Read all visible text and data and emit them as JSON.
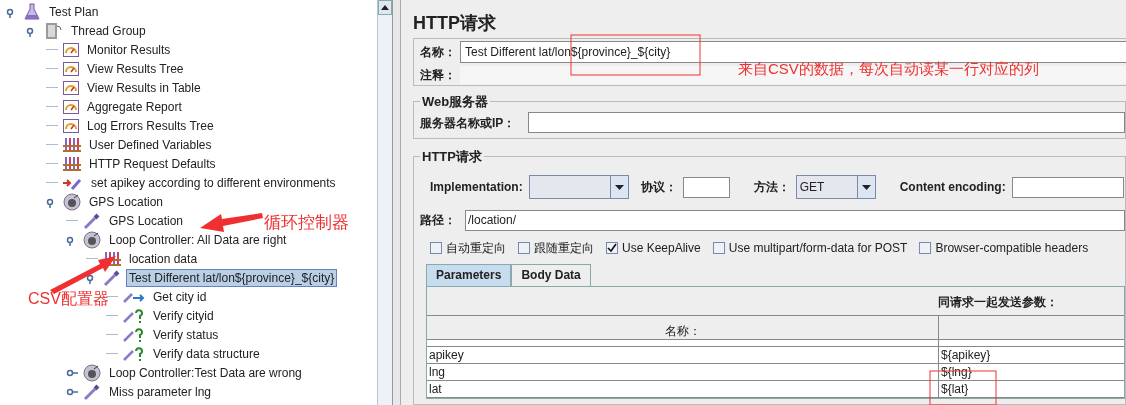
{
  "tree": [
    {
      "label": "Test Plan",
      "kind": "plan",
      "selected": false,
      "expanded": true,
      "children": [
        {
          "label": "Thread Group",
          "kind": "thread",
          "selected": false,
          "expanded": true,
          "children": [
            {
              "label": "Monitor Results",
              "kind": "listener",
              "selected": false
            },
            {
              "label": "View Results Tree",
              "kind": "listener",
              "selected": false
            },
            {
              "label": "View Results in Table",
              "kind": "listener",
              "selected": false
            },
            {
              "label": "Aggregate Report",
              "kind": "listener",
              "selected": false
            },
            {
              "label": "Log Errors Results Tree",
              "kind": "listener",
              "selected": false
            },
            {
              "label": "User Defined Variables",
              "kind": "config",
              "selected": false
            },
            {
              "label": "HTTP Request Defaults",
              "kind": "config",
              "selected": false
            },
            {
              "label": "set apikey according to different environments",
              "kind": "preprocessor",
              "selected": false
            },
            {
              "label": "GPS Location",
              "kind": "controller",
              "selected": false,
              "expanded": true,
              "children": [
                {
                  "label": "GPS Location",
                  "kind": "sampler",
                  "selected": false
                },
                {
                  "label": "Loop Controller: All Data are right",
                  "kind": "controller",
                  "selected": false,
                  "expanded": true,
                  "children": [
                    {
                      "label": "location data",
                      "kind": "config",
                      "selected": false
                    },
                    {
                      "label": "Test Different lat/lon${province}_${city}",
                      "kind": "sampler",
                      "selected": true,
                      "expanded": true,
                      "children": [
                        {
                          "label": "Get city id",
                          "kind": "extractor",
                          "selected": false
                        },
                        {
                          "label": "Verify cityid",
                          "kind": "assertion",
                          "selected": false
                        },
                        {
                          "label": "Verify status",
                          "kind": "assertion",
                          "selected": false
                        },
                        {
                          "label": "Verify data structure",
                          "kind": "assertion",
                          "selected": false
                        }
                      ]
                    }
                  ]
                },
                {
                  "label": "Loop Controller:Test Data are wrong",
                  "kind": "controller",
                  "selected": false,
                  "expanded": false
                },
                {
                  "label": "Miss parameter lng",
                  "kind": "sampler",
                  "selected": false,
                  "expanded": false
                }
              ]
            }
          ]
        }
      ]
    }
  ],
  "panel": {
    "title": "HTTP请求",
    "name_label": "名称：",
    "name_value": "Test Different lat/lon${province}_${city}",
    "comment_label": "注释：",
    "web_server": {
      "legend": "Web服务器",
      "server_label": "服务器名称或IP："
    },
    "http_request": {
      "legend": "HTTP请求",
      "implementation_label": "Implementation:",
      "protocol_label": "协议：",
      "method_label": "方法：",
      "method_value": "GET",
      "encoding_label": "Content encoding:",
      "path_label": "路径：",
      "path_value": "/location/",
      "options": [
        {
          "label": "自动重定向",
          "checked": false
        },
        {
          "label": "跟随重定向",
          "checked": false
        },
        {
          "label": "Use KeepAlive",
          "checked": true
        },
        {
          "label": "Use multipart/form-data for POST",
          "checked": false
        },
        {
          "label": "Browser-compatible headers",
          "checked": false
        }
      ],
      "tabs": [
        {
          "label": "Parameters",
          "selected": true
        },
        {
          "label": "Body Data",
          "selected": false
        }
      ],
      "params_caption": "同请求一起发送参数：",
      "columns": [
        "名称："
      ],
      "rows": [
        [
          "apikey",
          "${apikey}"
        ],
        [
          "lng",
          "${lng}"
        ],
        [
          "lat",
          "${lat}"
        ]
      ]
    }
  },
  "annotations": [
    {
      "text": "循环控制器"
    },
    {
      "text": "CSV配置器"
    },
    {
      "text": "来自CSV的数据，每次自动读某一行对应的列"
    }
  ]
}
